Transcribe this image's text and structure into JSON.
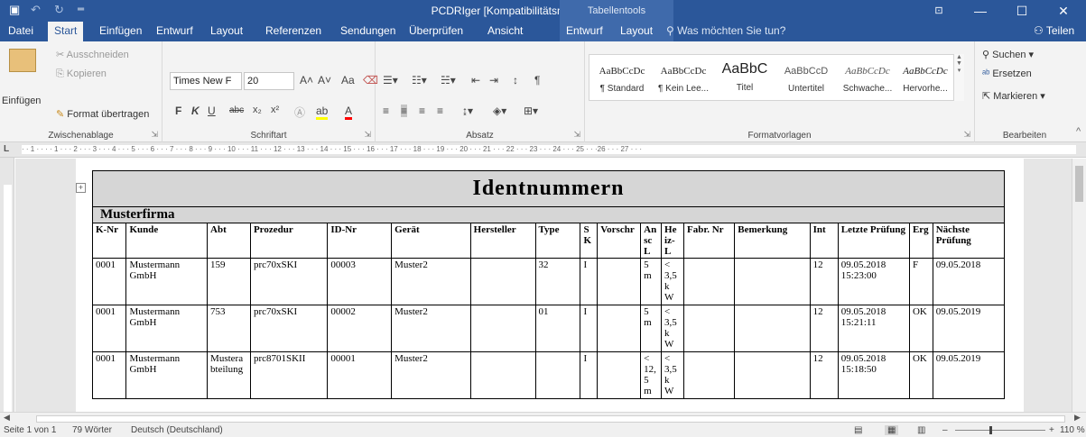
{
  "titlebar": {
    "title": "PCDRIger [Kompatibilitätsmodus] - Word",
    "context": "Tabellentools",
    "save_icon": "save-icon",
    "undo_icon": "undo-icon",
    "redo_icon": "redo-icon",
    "customize_icon": "customize-icon",
    "minimize": "—",
    "maximize": "☐",
    "close": "✕",
    "ribbon_display": "⊡"
  },
  "tabs": [
    "Datei",
    "Start",
    "Einfügen",
    "Entwurf",
    "Layout",
    "Referenzen",
    "Sendungen",
    "Überprüfen",
    "Ansicht",
    "Entwurf",
    "Layout"
  ],
  "active_tab": "Start",
  "tell_me": "Was möchten Sie tun?",
  "share": "Teilen",
  "clipboard": {
    "paste": "Einfügen",
    "cut": "Ausschneiden",
    "copy": "Kopieren",
    "format_painter": "Format übertragen",
    "label": "Zwischenablage"
  },
  "font": {
    "name": "Times New F",
    "size": "20",
    "bold": "F",
    "italic": "K",
    "underline": "U",
    "strike": "abc",
    "sub": "x₂",
    "sup": "x²",
    "grow": "A˄",
    "shrink": "A˅",
    "case": "Aa",
    "label": "Schriftart"
  },
  "paragraph": {
    "label": "Absatz"
  },
  "styles": {
    "items": [
      {
        "sample": "AaBbCcDc",
        "name": "¶ Standard"
      },
      {
        "sample": "AaBbCcDc",
        "name": "¶ Kein Lee..."
      },
      {
        "sample": "AaBbC",
        "name": "Titel"
      },
      {
        "sample": "AaBbCcD",
        "name": "Untertitel"
      },
      {
        "sample": "AaBbCcDc",
        "name": "Schwache..."
      },
      {
        "sample": "AaBbCcDc",
        "name": "Hervorhe..."
      }
    ],
    "label": "Formatvorlagen"
  },
  "editing": {
    "find": "Suchen",
    "replace": "Ersetzen",
    "select": "Markieren",
    "label": "Bearbeiten"
  },
  "ruler": {
    "text": "· · 1 · · · · 1 · · · 2 · · · 3 · · · 4 · · · 5 · · · 6 · · · 7 · · · 8 · · · 9 · · · 10 · · · 11 · · · 12 · · · 13 · · · 14 · · · 15 · · · 16 · · · 17 · · · 18 · · · 19 · · · 20 · · · 21 · · · 22 · · · 23 · · · 24 · · · 25 · · ·26 · · · 27 · · ·"
  },
  "document": {
    "title": "Identnummern",
    "company": "Musterfirma",
    "headers": [
      "K-Nr",
      "Kunde",
      "Abt",
      "Prozedur",
      "ID-Nr",
      "Gerät",
      "Hersteller",
      "Type",
      "S K",
      "Vorschr",
      "An sc L",
      "He iz- L",
      "Fabr. Nr",
      "Bemerkung",
      "Int",
      "Letzte Prüfung",
      "Erg",
      "Nächste Prüfung"
    ],
    "rows": [
      [
        "0001",
        "Mustermann GmbH",
        "159",
        "prc70xSKI",
        "00003",
        "Muster2",
        "",
        "32",
        "I",
        "",
        "5 m",
        "< 3,5 k W",
        "",
        "",
        "12",
        "09.05.2018 15:23:00",
        "F",
        "09.05.2018"
      ],
      [
        "0001",
        "Mustermann GmbH",
        "753",
        "prc70xSKI",
        "00002",
        "Muster2",
        "",
        "01",
        "I",
        "",
        "5 m",
        "< 3,5 k W",
        "",
        "",
        "12",
        "09.05.2018 15:21:11",
        "OK",
        "09.05.2019"
      ],
      [
        "0001",
        "Mustermann GmbH",
        "Mustera bteilung",
        "prc8701SKII",
        "00001",
        "Muster2",
        "",
        "",
        "I",
        "",
        "< 12, 5 m",
        "< 3,5 k W",
        "",
        "",
        "12",
        "09.05.2018 15:18:50",
        "OK",
        "09.05.2019"
      ]
    ]
  },
  "status": {
    "page": "Seite 1 von 1",
    "words": "79 Wörter",
    "language": "Deutsch (Deutschland)",
    "zoom": "110 %"
  }
}
